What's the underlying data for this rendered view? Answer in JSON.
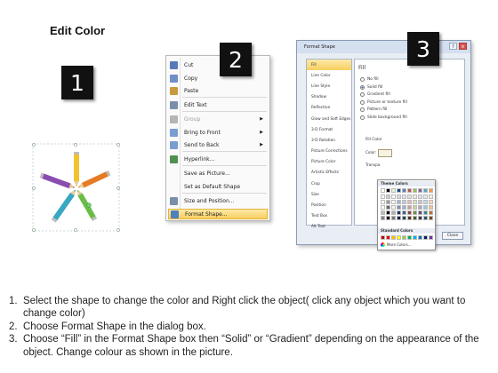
{
  "title": "Edit Color",
  "steps": [
    "1",
    "2",
    "3"
  ],
  "context_menu": {
    "items": [
      {
        "label": "Cut",
        "icon": "scissors-icon",
        "color": "#5a79b8",
        "enabled": true,
        "submenu": false
      },
      {
        "label": "Copy",
        "icon": "copy-icon",
        "color": "#6f8fc8",
        "enabled": true,
        "submenu": false
      },
      {
        "label": "Paste",
        "icon": "paste-icon",
        "color": "#c79a3c",
        "enabled": true,
        "submenu": false
      },
      {
        "label": "Edit Text",
        "icon": "edit-text-icon",
        "color": "#7b8fa8",
        "enabled": true,
        "submenu": false
      },
      {
        "label": "Group",
        "icon": "group-icon",
        "color": "#b5b5b5",
        "enabled": false,
        "submenu": true
      },
      {
        "label": "Bring to Front",
        "icon": "bring-to-front-icon",
        "color": "#7a9dd0",
        "enabled": true,
        "submenu": true
      },
      {
        "label": "Send to Back",
        "icon": "send-to-back-icon",
        "color": "#7a9dd0",
        "enabled": true,
        "submenu": true
      },
      {
        "label": "Hyperlink...",
        "icon": "hyperlink-icon",
        "color": "#4f8f4f",
        "enabled": true,
        "submenu": false
      },
      {
        "label": "Save as Picture...",
        "icon": "",
        "color": "",
        "enabled": true,
        "submenu": false
      },
      {
        "label": "Set as Default Shape",
        "icon": "",
        "color": "",
        "enabled": true,
        "submenu": false
      },
      {
        "label": "Size and Position...",
        "icon": "size-position-icon",
        "color": "#7b8fa8",
        "enabled": true,
        "submenu": false
      },
      {
        "label": "Format Shape...",
        "icon": "format-shape-icon",
        "color": "#4f7fbf",
        "enabled": true,
        "submenu": false
      }
    ]
  },
  "dialog": {
    "title": "Format Shape",
    "controls": [
      "?",
      "×"
    ],
    "sidebar": [
      "Fill",
      "Line Color",
      "Line Style",
      "Shadow",
      "Reflection",
      "Glow and Soft Edges",
      "3-D Format",
      "3-D Rotation",
      "Picture Corrections",
      "Picture Color",
      "Artistic Effects",
      "Crop",
      "Size",
      "Position",
      "Text Box",
      "Alt Text"
    ],
    "fill_heading": "Fill",
    "options": [
      {
        "label": "No fill",
        "selected": false
      },
      {
        "label": "Solid fill",
        "selected": true
      },
      {
        "label": "Gradient fill",
        "selected": false
      },
      {
        "label": "Picture or texture fill",
        "selected": false
      },
      {
        "label": "Pattern fill",
        "selected": false
      },
      {
        "label": "Slide background fill",
        "selected": false
      }
    ],
    "fill_color_heading": "Fill Color",
    "color_label": "Color:",
    "transparency_label": "Transpa",
    "palette": {
      "theme_title": "Theme Colors",
      "standard_title": "Standard Colors",
      "more": "More Colors...",
      "theme_top": [
        "#ffffff",
        "#000000",
        "#eeece1",
        "#1f497d",
        "#4f81bd",
        "#c0504d",
        "#9bbb59",
        "#8064a2",
        "#4bacc6",
        "#f79646"
      ],
      "standard": [
        "#c00000",
        "#ff0000",
        "#ffc000",
        "#ffff00",
        "#92d050",
        "#00b050",
        "#00b0f0",
        "#0070c0",
        "#002060",
        "#7030a0"
      ]
    },
    "close_label": "Close"
  },
  "instructions": [
    {
      "num": "1.",
      "text": "Select the shape to change the color and Right click the object( click any object which you want to change color)"
    },
    {
      "num": "2.",
      "text": "Choose Format Shape in the dialog box."
    },
    {
      "num": "3.",
      "text": "Choose “Fill” in the Format Shape box then “Solid” or “Gradient” depending on the appearance of the object. Change colour as shown in the picture."
    }
  ],
  "pencil_colors": [
    "#f2c230",
    "#e57b25",
    "#3aa7c2",
    "#8a4db0",
    "#6cbd45"
  ]
}
